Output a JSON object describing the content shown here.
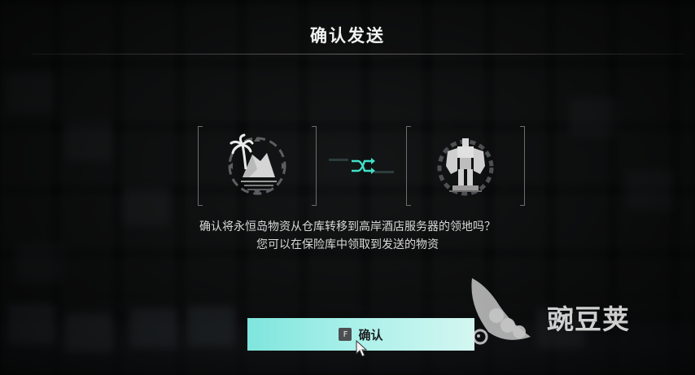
{
  "dialog": {
    "title": "确认发送",
    "message_line1": "确认将永恒岛物资从仓库转移到高岸酒店服务器的领地吗？",
    "message_line2": "您可以在保险库中领取到发送的物资"
  },
  "source_icon": "island-palm-icon",
  "swap_icon": "shuffle-arrows-icon",
  "target_icon": "mech-robot-icon",
  "confirm_button": {
    "key": "F",
    "label": "确认"
  },
  "watermark": {
    "text": "豌豆荚"
  },
  "colors": {
    "accent": "#3ee0c9",
    "button_start": "#7fe5dd",
    "button_end": "#d4f6f1"
  }
}
